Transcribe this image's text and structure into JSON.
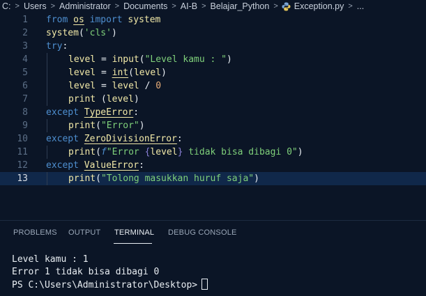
{
  "breadcrumb": {
    "items": [
      "C:",
      "Users",
      "Administrator",
      "Documents",
      "AI-B",
      "Belajar_Python",
      "Exception.py",
      "..."
    ]
  },
  "editor": {
    "line_numbers": [
      "1",
      "2",
      "3",
      "4",
      "5",
      "6",
      "7",
      "8",
      "9",
      "10",
      "11",
      "12",
      "13"
    ],
    "current_line": "13",
    "lines": {
      "l1": {
        "from": "from",
        "mod": "os",
        "import": "import",
        "name": "system"
      },
      "l2": {
        "fn": "system",
        "open": "(",
        "str": "'cls'",
        "close": ")"
      },
      "l3": {
        "kw": "try",
        "colon": ":"
      },
      "l4": {
        "var": "level",
        "eq": " = ",
        "fn": "input",
        "open": "(",
        "str": "\"Level kamu : \"",
        "close": ")"
      },
      "l5": {
        "var": "level",
        "eq": " = ",
        "fn": "int",
        "open": "(",
        "arg": "level",
        "close": ")"
      },
      "l6": {
        "var": "level",
        "eq": " = ",
        "var2": "level",
        "op": " / ",
        "num": "0"
      },
      "l7": {
        "fn": "print",
        "open": " (",
        "arg": "level",
        "close": ")"
      },
      "l8": {
        "kw": "except",
        "exc": "TypeError",
        "colon": ":"
      },
      "l9": {
        "fn": "print",
        "open": "(",
        "str": "\"Error\"",
        "close": ")"
      },
      "l10": {
        "kw": "except",
        "exc": "ZeroDivisionError",
        "colon": ":"
      },
      "l11": {
        "fn": "print",
        "open": "(",
        "prefix": "f",
        "str_a": "\"Error ",
        "brace_open": "{",
        "expr": "level",
        "brace_close": "}",
        "str_b": " tidak bisa dibagi 0\"",
        "close": ")"
      },
      "l12": {
        "kw": "except",
        "exc": "ValueError",
        "colon": ":"
      },
      "l13": {
        "fn": "print",
        "open": "(",
        "str": "\"Tolong masukkan huruf saja\"",
        "close": ")"
      }
    }
  },
  "panel": {
    "tabs": [
      "PROBLEMS",
      "OUTPUT",
      "TERMINAL",
      "DEBUG CONSOLE"
    ],
    "active_tab": "TERMINAL"
  },
  "terminal": {
    "lines": [
      "Level kamu : 1",
      "Error 1 tidak bisa dibagi 0",
      "PS C:\\Users\\Administrator\\Desktop>"
    ]
  },
  "colors": {
    "background": "#0b1526",
    "keyword": "#4e8fd0",
    "identifier": "#f2e9a8",
    "string": "#7fd07a",
    "number": "#e8ad78",
    "current_line": "#10284a"
  },
  "icons": {
    "file_type": "python-file-icon",
    "separator": "chevron-right-icon"
  }
}
